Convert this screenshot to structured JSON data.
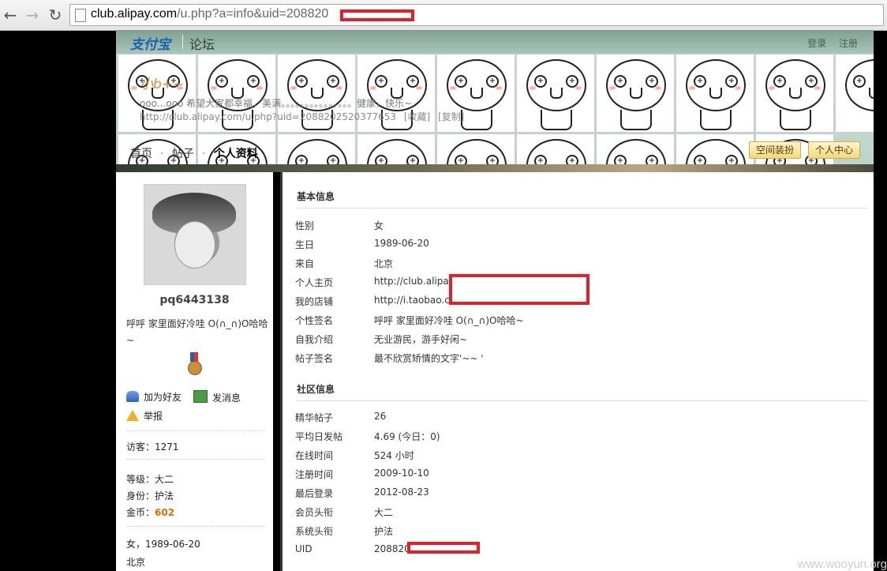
{
  "browser": {
    "url_host": "club.alipay.com",
    "url_rest": "/u.php?a=info&uid=208820",
    "back_icon": "←",
    "forward_icon": "→",
    "reload_icon": "↻"
  },
  "header": {
    "logo": "支付宝",
    "forum_title": "论坛",
    "login": "登录",
    "register": "注册",
    "nickname": "小b+~",
    "signature": "ooo...ooo 希望大家都幸福，美满。。。。。。。。。。。。。。。健康，快乐~",
    "profile_url": "http://club.alipay.com/u.php?uid=2088202520377653",
    "favorite": "[收藏]",
    "copy": "[复制]",
    "tabs": [
      "首页",
      "帖子",
      "个人资料"
    ],
    "space_decor_button": "空间装扮",
    "personal_center_button": "个人中心"
  },
  "sidebar": {
    "username": "pq6443138",
    "bio": "呼呼 家里面好冷哇 O(∩_∩)O哈哈~",
    "add_friend": "加为好友",
    "send_message": "发消息",
    "report": "举报",
    "visitors_label": "访客：",
    "visitors": "1271",
    "level_label": "等级：",
    "level": "大二",
    "identity_label": "身份：",
    "identity": "护法",
    "gold_label": "金币：",
    "gold": "602",
    "gender_birth": "女，1989-06-20",
    "city": "北京"
  },
  "basic_info": {
    "title": "基本信息",
    "rows": [
      {
        "label": "性别",
        "value": "女"
      },
      {
        "label": "生日",
        "value": "1989-06-20"
      },
      {
        "label": "来自",
        "value": "北京"
      },
      {
        "label": "个人主页",
        "value": "http://club.alipay"
      },
      {
        "label": "我的店铺",
        "value": "http://i.taobao.c"
      },
      {
        "label": "个性签名",
        "value": "呼呼 家里面好冷哇 O(∩_∩)O哈哈~"
      },
      {
        "label": "自我介绍",
        "value": "无业游民，游手好闲~"
      },
      {
        "label": "帖子签名",
        "value": "最不欣赏矫情的文字'~~ '"
      }
    ]
  },
  "community_info": {
    "title": "社区信息",
    "rows": [
      {
        "label": "精华帖子",
        "value": "26"
      },
      {
        "label": "平均日发帖",
        "value": "4.69 (今日：0)"
      },
      {
        "label": "在线时间",
        "value": "524 小时"
      },
      {
        "label": "注册时间",
        "value": "2009-10-10"
      },
      {
        "label": "最后登录",
        "value": "2012-08-23"
      },
      {
        "label": "会员头衔",
        "value": "大二"
      },
      {
        "label": "系统头衔",
        "value": "护法"
      },
      {
        "label": "UID",
        "value": "208820"
      }
    ]
  },
  "watermark": "www.wooyun.org"
}
